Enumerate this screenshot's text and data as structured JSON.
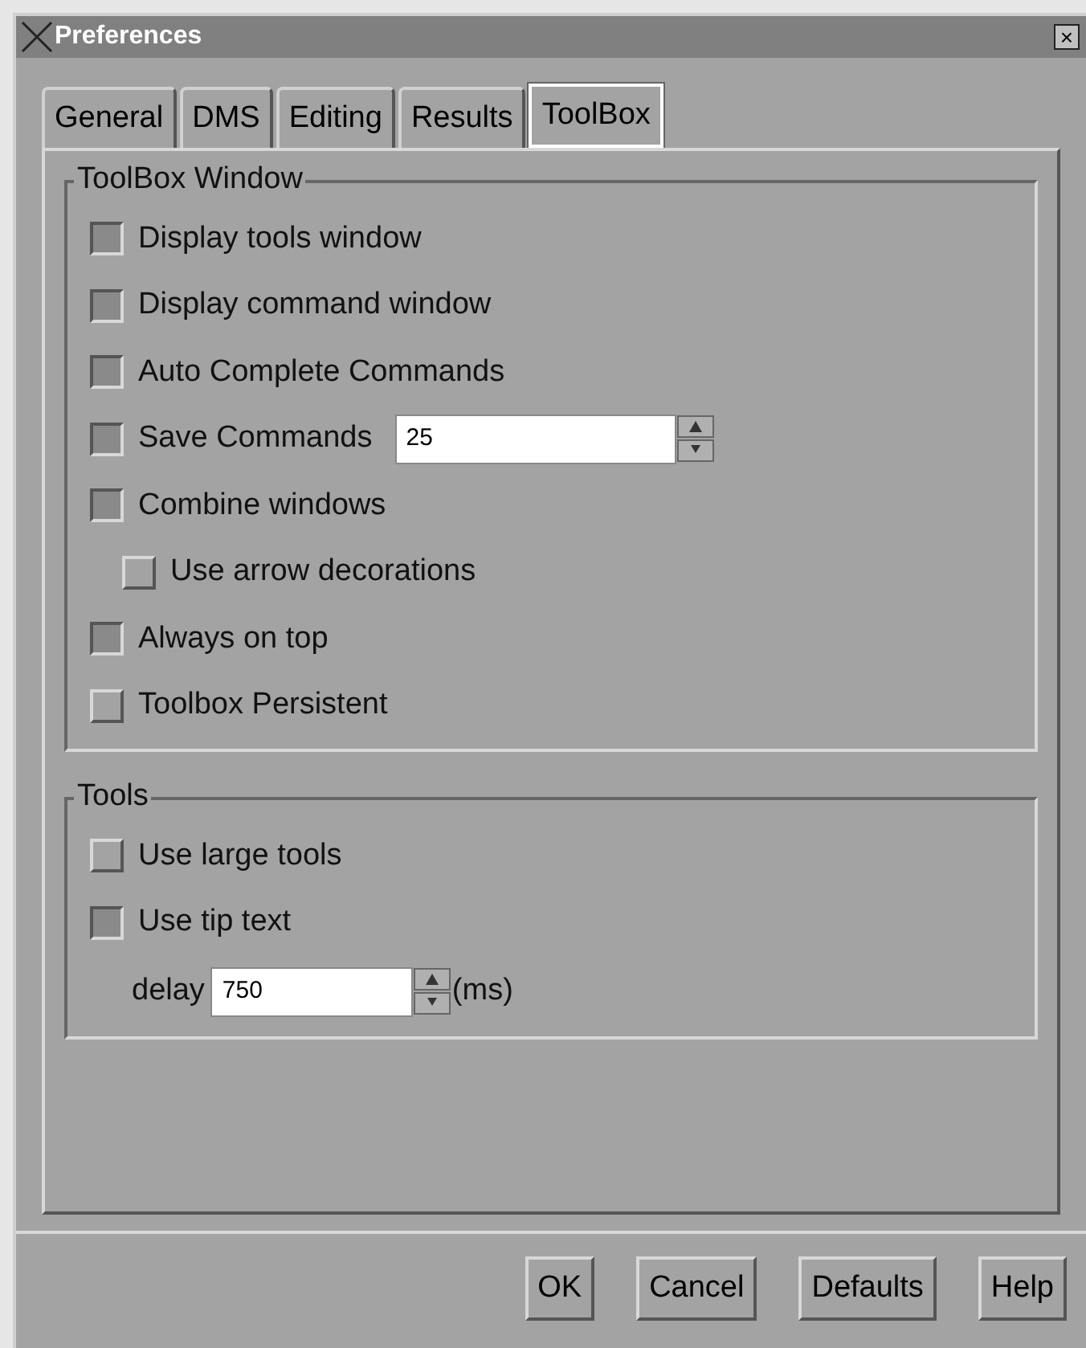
{
  "window": {
    "title": "Preferences",
    "close": "×"
  },
  "tabs": [
    {
      "label": "General",
      "selected": false
    },
    {
      "label": "DMS",
      "selected": false
    },
    {
      "label": "Editing",
      "selected": false
    },
    {
      "label": "Results",
      "selected": false
    },
    {
      "label": "ToolBox",
      "selected": true
    }
  ],
  "groups": [
    {
      "title": "ToolBox Window",
      "items": [
        {
          "kind": "checkbox",
          "label": "Display tools window",
          "checked": true
        },
        {
          "kind": "checkbox",
          "label": "Display command window",
          "checked": true
        },
        {
          "kind": "checkbox",
          "label": "Auto Complete Commands",
          "checked": true
        },
        {
          "kind": "checkbox",
          "label": "Save Commands",
          "checked": true,
          "value": "25"
        },
        {
          "kind": "checkbox",
          "label": "Combine windows",
          "checked": true,
          "children": [
            {
              "kind": "checkbox",
              "label": "Use arrow decorations",
              "checked": false
            }
          ]
        },
        {
          "kind": "checkbox",
          "label": "Always on top",
          "checked": true
        },
        {
          "kind": "checkbox",
          "label": "Toolbox Persistent",
          "checked": false
        }
      ]
    },
    {
      "title": "Tools",
      "items": [
        {
          "kind": "checkbox",
          "label": "Use large tools",
          "checked": false
        },
        {
          "kind": "checkbox",
          "label": "Use tip text",
          "checked": true
        },
        {
          "kind": "spin",
          "label": "delay",
          "value": "750",
          "unit": "(ms)"
        }
      ]
    }
  ],
  "buttons": [
    "OK",
    "Cancel",
    "Defaults",
    "Help"
  ]
}
